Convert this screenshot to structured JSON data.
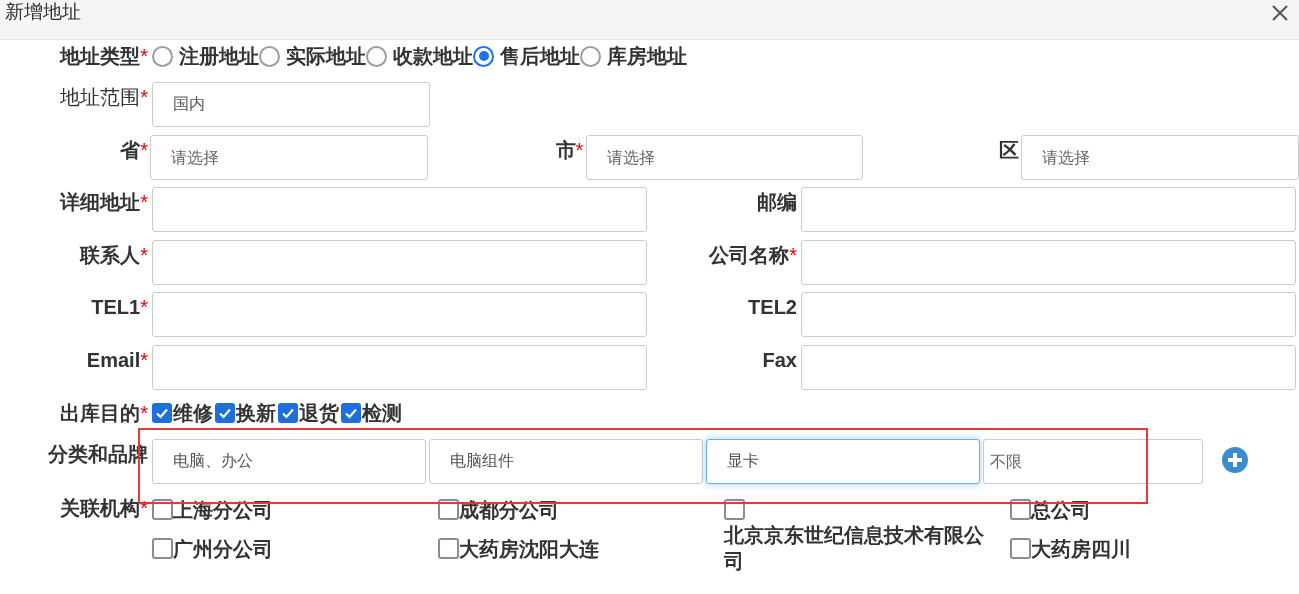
{
  "dialog": {
    "title": "新增地址",
    "required_mark": "*"
  },
  "address_type": {
    "label": "地址类型",
    "required": true,
    "options": [
      {
        "label": "注册地址",
        "selected": false
      },
      {
        "label": "实际地址",
        "selected": false
      },
      {
        "label": "收款地址",
        "selected": false
      },
      {
        "label": "售后地址",
        "selected": true
      },
      {
        "label": "库房地址",
        "selected": false
      }
    ]
  },
  "scope": {
    "label": "地址范围",
    "required": true,
    "value": "国内"
  },
  "region": [
    {
      "label": "省",
      "required": true,
      "placeholder": "请选择"
    },
    {
      "label": "市",
      "required": true,
      "placeholder": "请选择"
    },
    {
      "label": "区",
      "required": false,
      "placeholder": "请选择"
    }
  ],
  "field_rows": [
    [
      {
        "label": "详细地址",
        "required": true
      },
      {
        "label": "邮编",
        "required": false
      }
    ],
    [
      {
        "label": "联系人",
        "required": true
      },
      {
        "label": "公司名称",
        "required": true
      }
    ],
    [
      {
        "label": "TEL1",
        "required": true
      },
      {
        "label": "TEL2",
        "required": false
      }
    ],
    [
      {
        "label": "Email",
        "required": true
      },
      {
        "label": "Fax",
        "required": false
      }
    ]
  ],
  "purpose": {
    "label": "出库目的",
    "required": true,
    "options": [
      {
        "label": "维修",
        "checked": true
      },
      {
        "label": "换新",
        "checked": true
      },
      {
        "label": "退货",
        "checked": true
      },
      {
        "label": "检测",
        "checked": true
      }
    ]
  },
  "category": {
    "label": "分类和品牌",
    "required": false,
    "fields": [
      {
        "value": "电脑、办公",
        "focused": false
      },
      {
        "value": "电脑组件",
        "focused": false
      },
      {
        "value": "显卡",
        "focused": true
      },
      {
        "placeholder": "不限",
        "focused": false
      }
    ]
  },
  "institutions": {
    "label": "关联机构",
    "required": true,
    "options": [
      {
        "label": "上海分公司",
        "checked": false
      },
      {
        "label": "成都分公司",
        "checked": false
      },
      {
        "label": "北京京东世纪信息技术有限公司",
        "checked": false
      },
      {
        "label": "总公司",
        "checked": false
      },
      {
        "label": "广州分公司",
        "checked": false
      },
      {
        "label": "大药房沈阳大连",
        "checked": false
      },
      {
        "label": "大药房四川",
        "checked": false
      }
    ]
  }
}
